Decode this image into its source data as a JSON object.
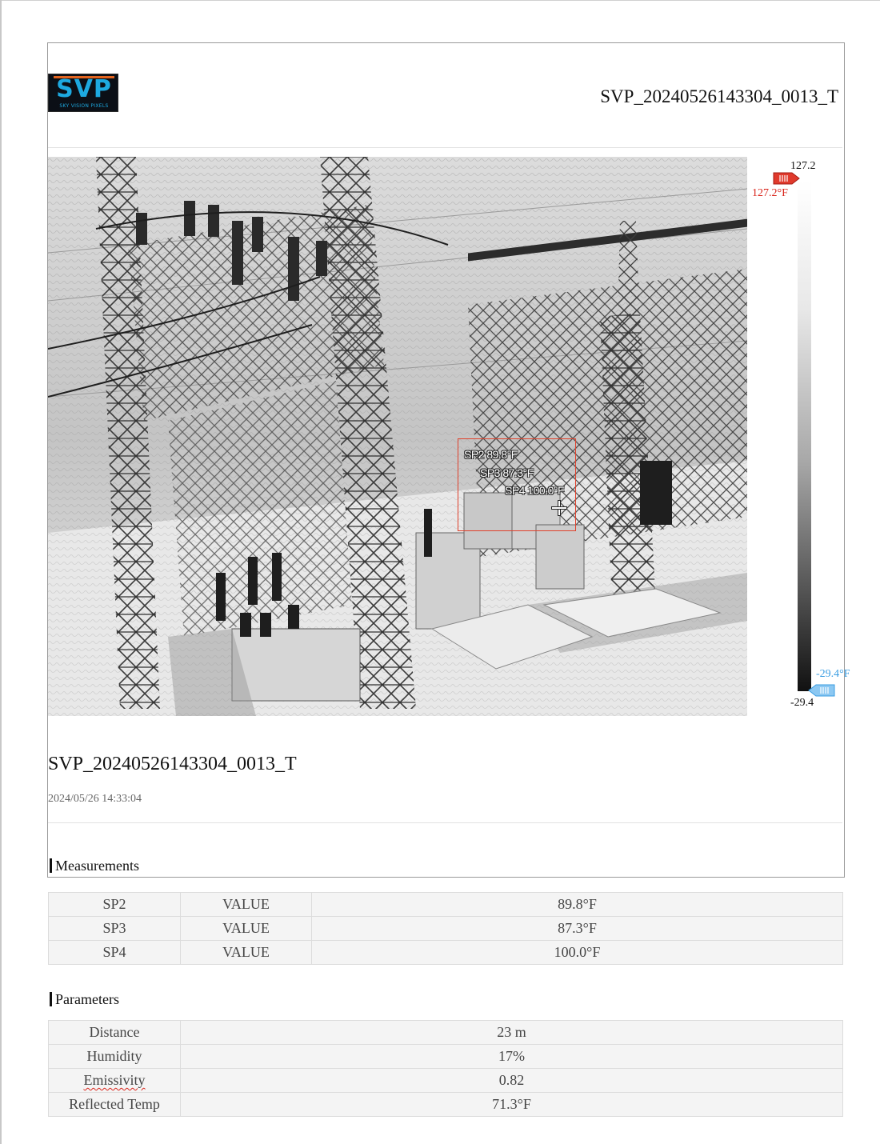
{
  "header": {
    "logo_text": "SVP",
    "logo_subtitle": "SKY VISION PIXELS",
    "title": "SVP_20240526143304_0013_T"
  },
  "thermal_image": {
    "spots": [
      {
        "label": "SP2 89.8°F"
      },
      {
        "label": "SP3 87.3°F"
      },
      {
        "label": "SP4 100.0°F"
      }
    ],
    "scale": {
      "max": "127.2",
      "min": "-29.4",
      "max_marker": "127.2°F",
      "min_marker": "-29.4°F",
      "max_color": "#d9261c",
      "min_color": "#3a9de2"
    }
  },
  "details": {
    "title": "SVP_20240526143304_0013_T",
    "timestamp": "2024/05/26 14:33:04"
  },
  "measurements": {
    "heading": "Measurements",
    "rows": [
      {
        "name": "SP2",
        "type": "VALUE",
        "value": "89.8°F"
      },
      {
        "name": "SP3",
        "type": "VALUE",
        "value": "87.3°F"
      },
      {
        "name": "SP4",
        "type": "VALUE",
        "value": "100.0°F"
      }
    ]
  },
  "parameters": {
    "heading": "Parameters",
    "rows": [
      {
        "name": "Distance",
        "value": "23 m"
      },
      {
        "name": "Humidity",
        "value": "17%"
      },
      {
        "name": "Emissivity",
        "value": "0.82"
      },
      {
        "name": "Reflected Temp",
        "value": "71.3°F"
      }
    ]
  }
}
